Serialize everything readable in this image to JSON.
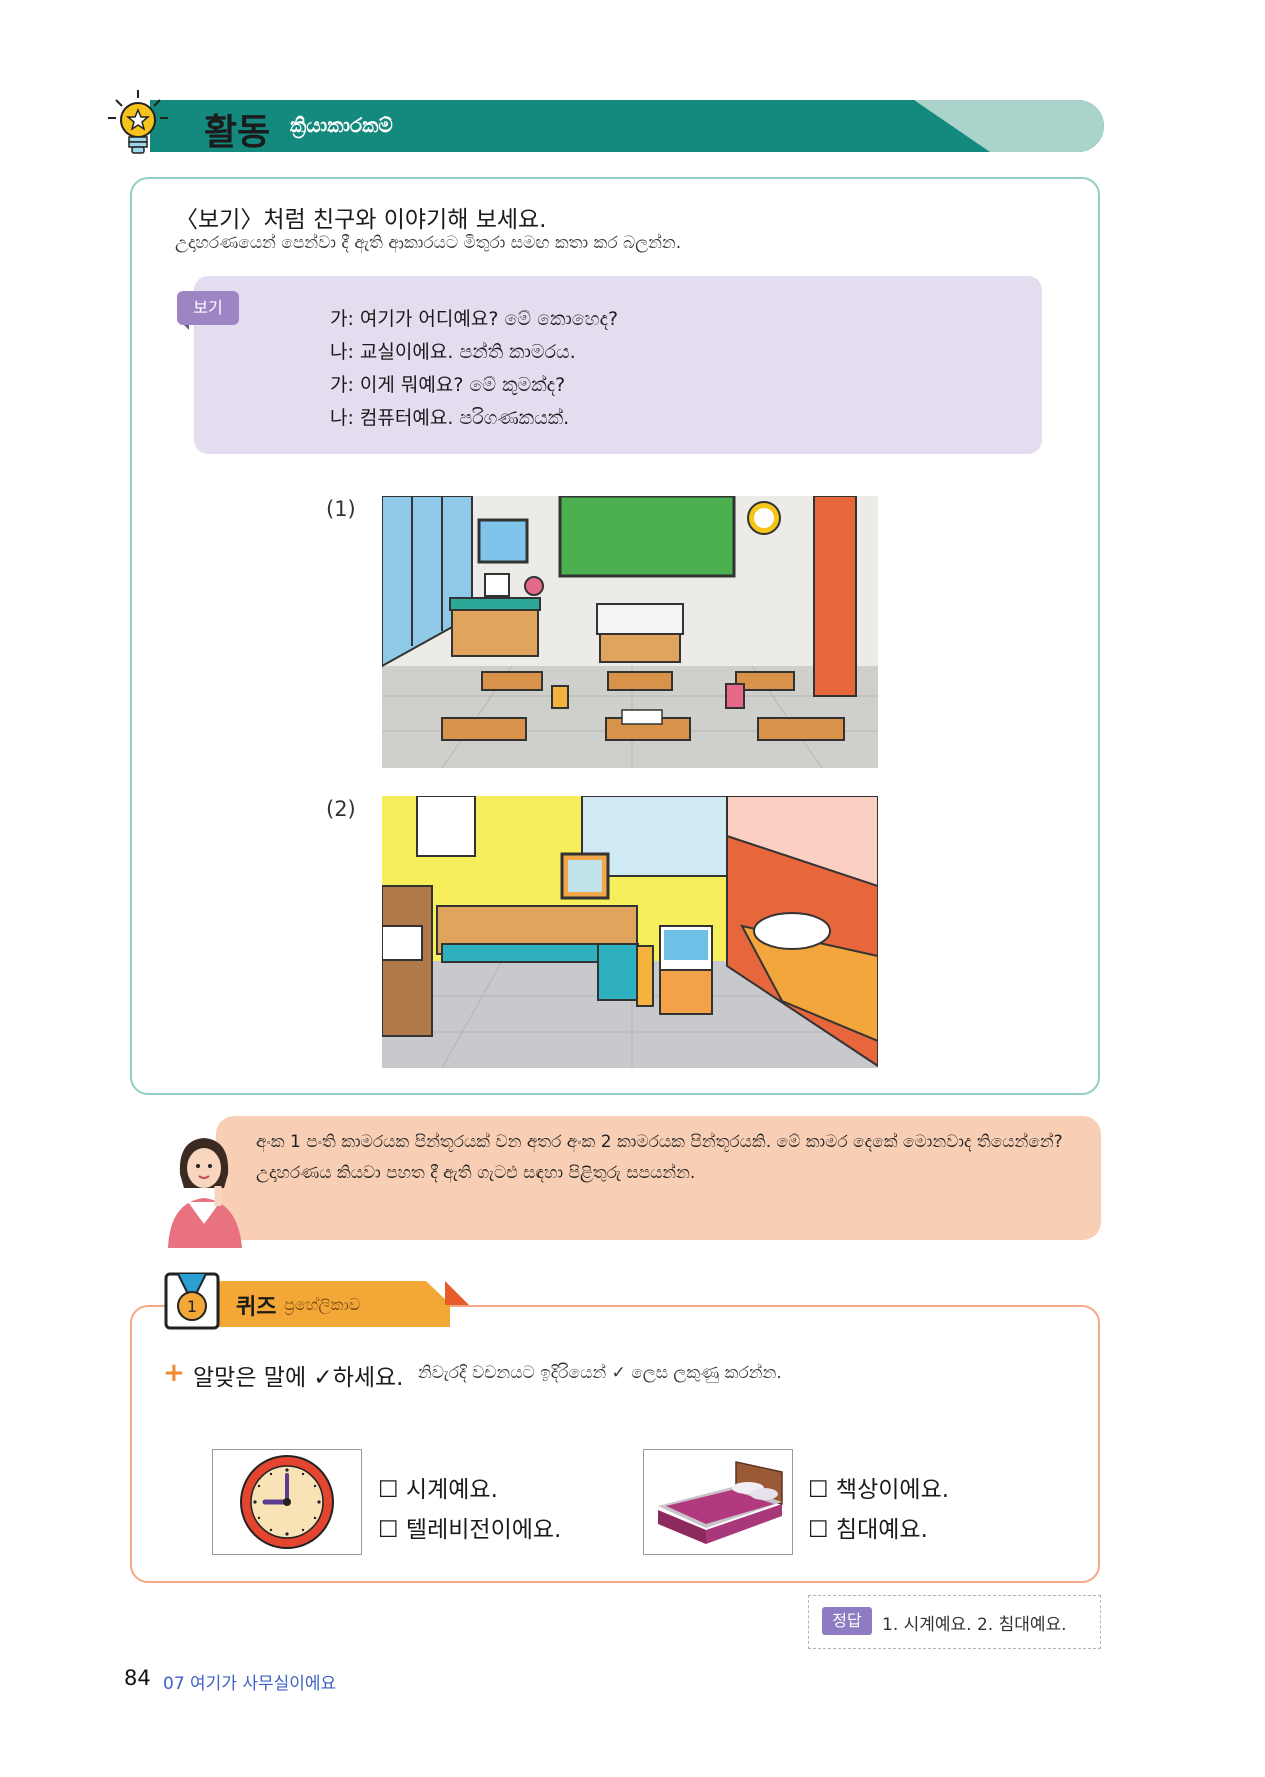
{
  "activity": {
    "title_ko": "활동",
    "title_si": "ක්‍රියාකාරකම්",
    "instruction_ko": "〈보기〉처럼 친구와 이야기해 보세요.",
    "instruction_si": "උදාහරණයෙන් පෙන්වා දී ඇති ආකාරයට මිතුරා සමඟ කතා කර බලන්න.",
    "example_badge": "보기",
    "example_lines": [
      "가: 여기가 어디예요? මේ කොහෙද?",
      "나: 교실이에요. පන්ති කාමරය.",
      "가: 이게 뭐예요? මේ කුමක්ද?",
      "나: 컴퓨터예요. පරිගණකයක්."
    ],
    "pictures": [
      {
        "label": "(1)",
        "scene": "classroom"
      },
      {
        "label": "(2)",
        "scene": "bedroom"
      }
    ]
  },
  "note": {
    "text": "අංක 1 පංති කාමරයක පින්තූරයක් වන අතර අංක 2 කාමරයක පින්තූරයකි. මේ කාමර දෙකේ මොනවාද තියෙන්නේ? උදාහරණය කියවා පහත දී ඇති ගැටළු සඳහා පිළිතුරු සපයන්න."
  },
  "quiz": {
    "title_ko": "퀴즈",
    "title_si": "ප්‍රහේලිකාව",
    "medal_number": "1",
    "instruction_ko": "알맞은 말에 ✓하세요.",
    "instruction_si": "නිවැරදි වචනයට ඉදිරියෙන් ✓ ලෙස ලකුණු කරන්න.",
    "items": [
      {
        "image": "clock",
        "options": [
          "☐ 시계예요.",
          "☐ 텔레비전이에요."
        ]
      },
      {
        "image": "bed",
        "options": [
          "☐ 책상이에요.",
          "☐ 침대예요."
        ]
      }
    ]
  },
  "answer": {
    "badge": "정답",
    "text": "1. 시계예요.  2. 침대예요."
  },
  "footer": {
    "page_number": "84",
    "chapter": "07 여기가 사무실이에요"
  },
  "colors": {
    "teal": "#148a7e",
    "lavender": "#e4dcef",
    "peach": "#f8cfb5",
    "orange": "#f2a736"
  }
}
